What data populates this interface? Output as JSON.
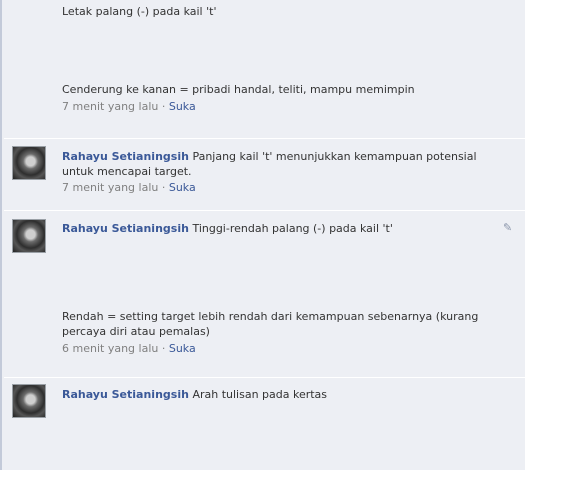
{
  "comments": [
    {
      "line1": "Letak palang (-) pada kail 't'",
      "line2": "Cenderung ke kanan = pribadi handal, teliti, mampu memimpin",
      "time": "7 menit yang lalu",
      "sep": " · ",
      "like": "Suka"
    },
    {
      "author": "Rahayu Setianingsih",
      "text": "Panjang kail 't' menunjukkan kemampuan potensial untuk mencapai target.",
      "time": "7 menit yang lalu",
      "sep": " · ",
      "like": "Suka"
    },
    {
      "author": "Rahayu Setianingsih",
      "line1": "Tinggi-rendah palang (-) pada kail 't'",
      "line2": "Rendah = setting target lebih rendah dari kemampuan sebenarnya (kurang percaya diri atau pemalas)",
      "time": "6 menit yang lalu",
      "sep": " · ",
      "like": "Suka",
      "edit_icon": "pencil-icon"
    },
    {
      "author": "Rahayu Setianingsih",
      "text": "Arah tulisan pada kertas"
    }
  ]
}
